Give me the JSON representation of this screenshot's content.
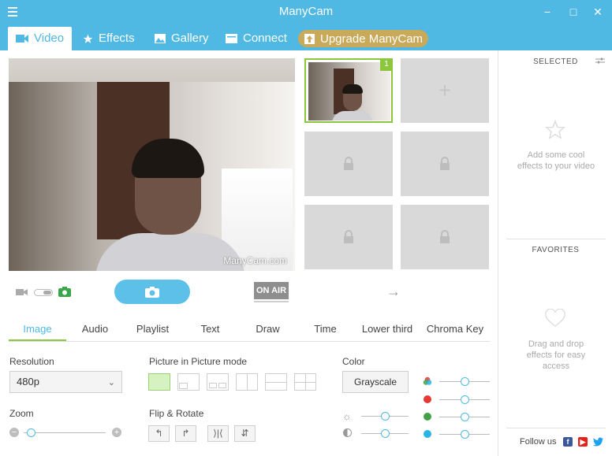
{
  "window": {
    "title": "ManyCam",
    "minimize": "−",
    "maximize": "□",
    "close": "✕"
  },
  "tabs": [
    {
      "label": "Video",
      "icon": "video-camera-icon"
    },
    {
      "label": "Effects",
      "icon": "star-icon"
    },
    {
      "label": "Gallery",
      "icon": "image-icon"
    },
    {
      "label": "Connect",
      "icon": "monitor-icon"
    }
  ],
  "upgrade": {
    "label": "Upgrade ManyCam",
    "icon": "upgrade-icon"
  },
  "video": {
    "watermark": "ManyCam.com"
  },
  "layers": {
    "active_badge": "1",
    "add_symbol": "+"
  },
  "controls": {
    "on_air": "ON AIR",
    "arrow": "→"
  },
  "bottom_tabs": [
    "Image",
    "Audio",
    "Playlist",
    "Text",
    "Draw",
    "Time",
    "Lower third",
    "Chroma Key"
  ],
  "image_panel": {
    "resolution_label": "Resolution",
    "resolution_value": "480p",
    "zoom_label": "Zoom",
    "zoom_level": 0.0,
    "pip_label": "Picture in Picture mode",
    "flip_label": "Flip & Rotate",
    "color_label": "Color",
    "grayscale_label": "Grayscale",
    "brightness_level": 0.5,
    "contrast_level": 0.5,
    "rgb_level": 0.5,
    "red_level": 0.5,
    "green_level": 0.5,
    "blue_level": 0.5
  },
  "right_panel": {
    "selected_header": "SELECTED",
    "selected_hint": "Add some cool effects to your video",
    "favorites_header": "FAVORITES",
    "favorites_hint": "Drag and drop effects for easy access",
    "follow_label": "Follow us"
  },
  "colors": {
    "accent": "#4fb8e3",
    "active_green": "#8cc63f",
    "upgrade_gold": "#c9a95a",
    "red": "#e53935",
    "green": "#43a047",
    "blue": "#29b6e6"
  }
}
